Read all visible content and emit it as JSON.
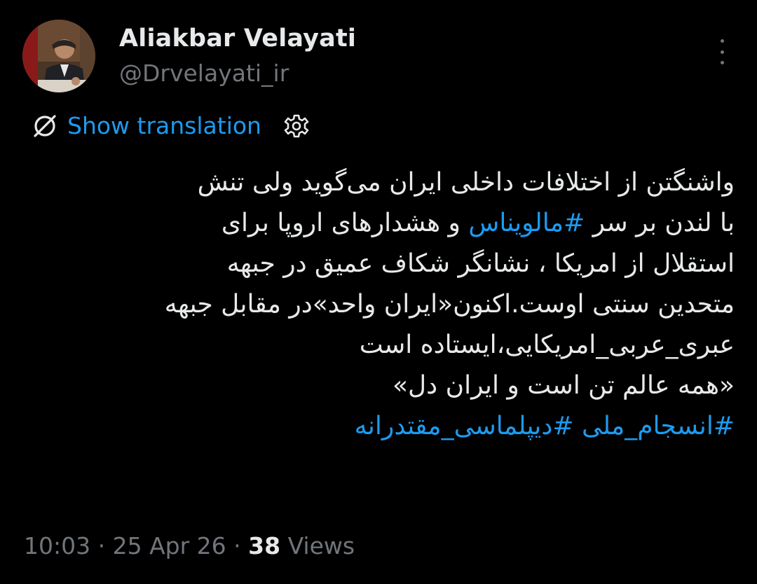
{
  "author": {
    "display_name": "Aliakbar Velayati",
    "handle": "@Drvelayati_ir",
    "avatar_icon": "profile-photo"
  },
  "more_icon": "more-vertical-icon",
  "translation": {
    "label": "Show translation",
    "icon": "translate-icon",
    "settings_icon": "gear-icon"
  },
  "tweet": {
    "line1": "واشنگتن از اختلافات داخلی ایران می‌گوید ولی تنش",
    "line2_before": "با لندن بر سر ",
    "line2_hashtag": "#مالویناس",
    "line2_after": " و هشدارهای اروپا برای",
    "line3": "استقلال از امریکا ، نشانگر شکاف عمیق در جبهه",
    "line4": "متحدین سنتی اوست.اکنون«ایران واحد»در مقابل جبهه",
    "line5": "عبری_عربی_امریکایی،ایستاده است",
    "line6": "«همه عالم تن است و ایران دل»",
    "hashtag_1": "#انسجام_ملی",
    "hashtag_2": "#دیپلماسی_مقتدرانه"
  },
  "meta": {
    "time": "10:03",
    "separator": " · ",
    "date": "25 Apr 26",
    "views_count": "38",
    "views_label": " Views"
  },
  "colors": {
    "background": "#000000",
    "text": "#e7e9ea",
    "secondary": "#71767b",
    "accent": "#1d9bf0"
  }
}
